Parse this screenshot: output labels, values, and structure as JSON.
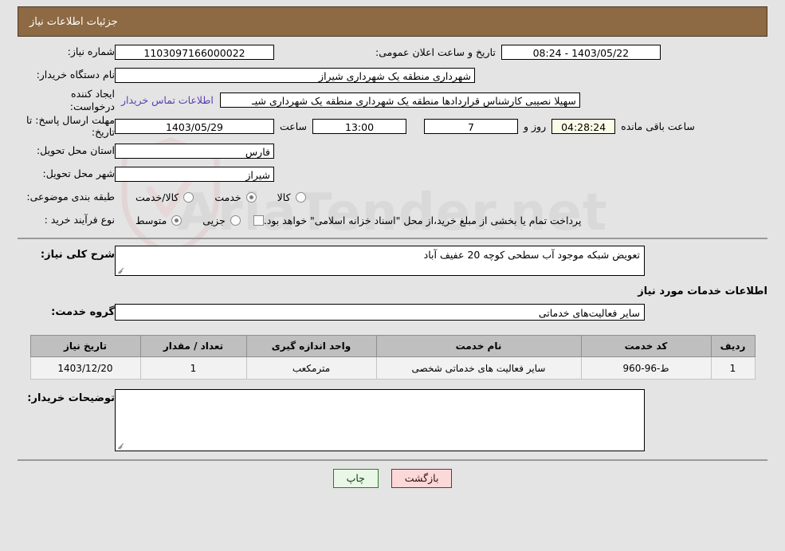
{
  "header": {
    "title": "جزئیات اطلاعات نیاز",
    "bar_color": "#8d6a43"
  },
  "watermark": {
    "text": "AriaTender.net"
  },
  "details": {
    "need_number_label": "شماره نیاز:",
    "need_number_value": "1103097166000022",
    "public_announce_label": "تاریخ و ساعت اعلان عمومی:",
    "public_announce_value": "1403/05/22 - 08:24",
    "buyer_org_label": "نام دستگاه خریدار:",
    "buyer_org_value": "شهرداری منطقه یک شهرداری شیراز",
    "creator_label": "ایجاد کننده درخواست:",
    "creator_value": "سهیلا نصیبی کارشناس قراردادها منطقه یک شهرداری منطقه یک شهرداری شیـ",
    "contact_link": "اطلاعات تماس خریدار",
    "deadline_label": "مهلت ارسال پاسخ: تا تاریخ:",
    "deadline_date": "1403/05/29",
    "deadline_time_label": "ساعت",
    "deadline_time": "13:00",
    "remaining_days": "7",
    "days_and_label": "روز و",
    "remaining_time": "04:28:24",
    "remaining_suffix": "ساعت باقی مانده",
    "province_label": "استان محل تحویل:",
    "province_value": "فارس",
    "city_label": "شهر محل تحویل:",
    "city_value": "شیراز",
    "category_label": "طبقه بندی موضوعی:",
    "category_options": [
      {
        "label": "کالا",
        "checked": false
      },
      {
        "label": "خدمت",
        "checked": true
      },
      {
        "label": "کالا/خدمت",
        "checked": false
      }
    ],
    "process_label": "نوع فرآیند خرید :",
    "process_options": [
      {
        "label": "جزیی",
        "checked": false
      },
      {
        "label": "متوسط",
        "checked": true
      }
    ],
    "treasury_checkbox_checked": false,
    "treasury_note": "پرداخت تمام یا بخشی از مبلغ خرید،از محل \"اسناد خزانه اسلامی\" خواهد بود."
  },
  "description": {
    "label": "شرح کلی نیاز:",
    "value": "تعویض شبکه موجود آب سطحی کوچه 20 عفیف آباد"
  },
  "services": {
    "heading": "اطلاعات خدمات مورد نیاز",
    "group_label": "گروه خدمت:",
    "group_value": "سایر فعالیت‌های خدماتی",
    "table": {
      "columns": [
        "ردیف",
        "کد خدمت",
        "نام خدمت",
        "واحد اندازه گیری",
        "تعداد / مقدار",
        "تاریخ نیاز"
      ],
      "rows": [
        {
          "index": "1",
          "code": "ط-96-960",
          "name": "سایر فعالیت های خدماتی شخصی",
          "unit": "مترمکعب",
          "quantity": "1",
          "need_date": "1403/12/20"
        }
      ]
    }
  },
  "buyer_notes": {
    "label": "توضیحات خریدار:",
    "value": ""
  },
  "footer": {
    "print_label": "چاپ",
    "back_label": "بازگشت"
  }
}
